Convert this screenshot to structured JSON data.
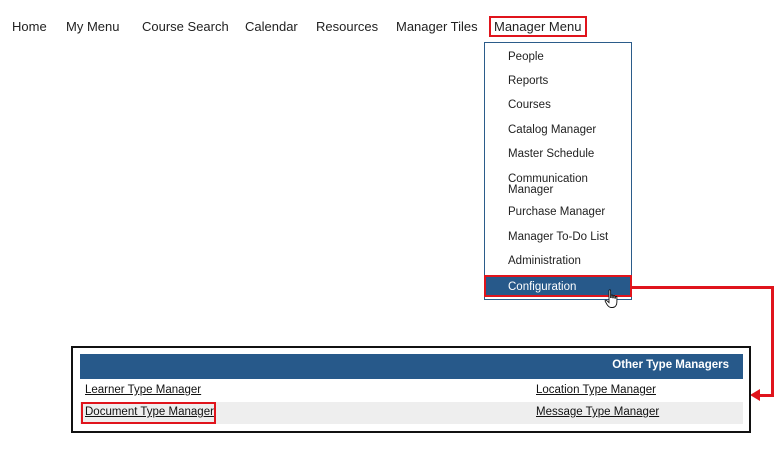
{
  "nav": {
    "items": [
      "Home",
      "My Menu",
      "Course Search",
      "Calendar",
      "Resources",
      "Manager Tiles"
    ],
    "active": "Manager Menu"
  },
  "dropdown": {
    "items": [
      "People",
      "Reports",
      "Courses",
      "Catalog Manager",
      "Master Schedule",
      "Communication Manager",
      "Purchase Manager",
      "Manager To-Do List",
      "Administration"
    ],
    "selected": "Configuration"
  },
  "panel": {
    "title": "Other Type Managers",
    "rows": [
      {
        "left": "Learner Type Manager",
        "right": "Location Type Manager"
      },
      {
        "left": "Document Type Manager",
        "right": "Message Type Manager"
      }
    ]
  },
  "colors": {
    "accent_blue": "#27598a",
    "highlight_red": "#e0141c",
    "row_alt": "#eeeeee"
  }
}
